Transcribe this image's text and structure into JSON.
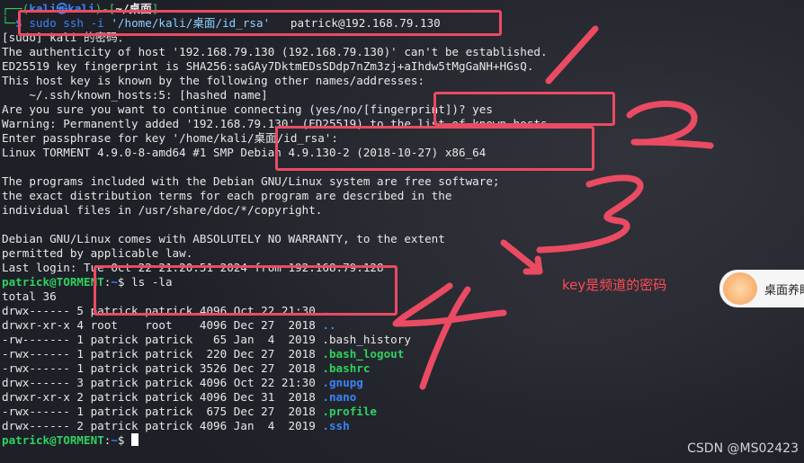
{
  "terminal": {
    "lines": [
      {
        "segments": [
          {
            "t": "┌──(",
            "c": "green"
          },
          {
            "t": "kali㉿kali",
            "c": "boldblue"
          },
          {
            "t": ")-[",
            "c": "green"
          },
          {
            "t": "~/桌面",
            "c": "bold"
          },
          {
            "t": "]",
            "c": "green"
          }
        ]
      },
      {
        "segments": [
          {
            "t": "└─",
            "c": "green"
          },
          {
            "t": "$ ",
            "c": "boldblue"
          },
          {
            "t": "sudo ssh -i ",
            "c": "blue"
          },
          {
            "t": "'/home/kali/桌面/id_rsa'",
            "c": "cyan"
          },
          {
            "t": "   patrick@192.168.79.130",
            "c": ""
          }
        ]
      },
      {
        "segments": [
          {
            "t": "[sudo] kali 的密码：",
            "c": ""
          }
        ]
      },
      {
        "segments": [
          {
            "t": "The authenticity of host '192.168.79.130 (192.168.79.130)' can't be established.",
            "c": ""
          }
        ]
      },
      {
        "segments": [
          {
            "t": "ED25519 key fingerprint is SHA256:saGAy7DktmEDsSDdp7nZm3zj+aIhdw5tMgGaNH+HGsQ.",
            "c": ""
          }
        ]
      },
      {
        "segments": [
          {
            "t": "This host key is known by the following other names/addresses:",
            "c": ""
          }
        ]
      },
      {
        "segments": [
          {
            "t": "    ~/.ssh/known_hosts:5: [hashed name]",
            "c": ""
          }
        ]
      },
      {
        "segments": [
          {
            "t": "Are you sure you want to continue connecting (yes/no/[fingerprint])? yes",
            "c": ""
          }
        ]
      },
      {
        "segments": [
          {
            "t": "Warning: Permanently added '192.168.79.130' (ED25519) to the list of known hosts.",
            "c": ""
          }
        ]
      },
      {
        "segments": [
          {
            "t": "Enter passphrase for key '/home/kali/桌面/id_rsa':",
            "c": ""
          }
        ]
      },
      {
        "segments": [
          {
            "t": "Linux TORMENT 4.9.0-8-amd64 #1 SMP Debian 4.9.130-2 (2018-10-27) x86_64",
            "c": ""
          }
        ]
      },
      {
        "segments": [
          {
            "t": "",
            "c": ""
          }
        ]
      },
      {
        "segments": [
          {
            "t": "The programs included with the Debian GNU/Linux system are free software;",
            "c": ""
          }
        ]
      },
      {
        "segments": [
          {
            "t": "the exact distribution terms for each program are described in the",
            "c": ""
          }
        ]
      },
      {
        "segments": [
          {
            "t": "individual files in /usr/share/doc/*/copyright.",
            "c": ""
          }
        ]
      },
      {
        "segments": [
          {
            "t": "",
            "c": ""
          }
        ]
      },
      {
        "segments": [
          {
            "t": "Debian GNU/Linux comes with ABSOLUTELY NO WARRANTY, to the extent",
            "c": ""
          }
        ]
      },
      {
        "segments": [
          {
            "t": "permitted by applicable law.",
            "c": ""
          }
        ]
      },
      {
        "segments": [
          {
            "t": "Last login: Tue Oct 22 21:20:51 2024 from 192.168.79.128",
            "c": ""
          }
        ]
      },
      {
        "segments": [
          {
            "t": "patrick@TORMENT",
            "c": "boldgreen"
          },
          {
            "t": ":",
            "c": ""
          },
          {
            "t": "~",
            "c": "boldblue"
          },
          {
            "t": "$ ls -la",
            "c": ""
          }
        ]
      },
      {
        "segments": [
          {
            "t": "total 36",
            "c": ""
          }
        ]
      },
      {
        "segments": [
          {
            "t": "drwx------ 5 patrick patrick 4096 Oct 22 21:30 ",
            "c": ""
          },
          {
            "t": ".",
            "c": "boldblue"
          }
        ]
      },
      {
        "segments": [
          {
            "t": "drwxr-xr-x 4 root    root    4096 Dec 27  2018 ",
            "c": ""
          },
          {
            "t": "..",
            "c": "boldblue"
          }
        ]
      },
      {
        "segments": [
          {
            "t": "-rw------- 1 patrick patrick   65 Jan  4  2019 .bash_history",
            "c": ""
          }
        ]
      },
      {
        "segments": [
          {
            "t": "-rwx------ 1 patrick patrick  220 Dec 27  2018 ",
            "c": ""
          },
          {
            "t": ".bash_logout",
            "c": "boldgreen"
          }
        ]
      },
      {
        "segments": [
          {
            "t": "-rwx------ 1 patrick patrick 3526 Dec 27  2018 ",
            "c": ""
          },
          {
            "t": ".bashrc",
            "c": "boldgreen"
          }
        ]
      },
      {
        "segments": [
          {
            "t": "drwx------ 3 patrick patrick 4096 Oct 22 21:30 ",
            "c": ""
          },
          {
            "t": ".gnupg",
            "c": "boldblue"
          }
        ]
      },
      {
        "segments": [
          {
            "t": "drwxr-xr-x 2 patrick patrick 4096 Dec 31  2018 ",
            "c": ""
          },
          {
            "t": ".nano",
            "c": "boldblue"
          }
        ]
      },
      {
        "segments": [
          {
            "t": "-rwx------ 1 patrick patrick  675 Dec 27  2018 ",
            "c": ""
          },
          {
            "t": ".profile",
            "c": "boldgreen"
          }
        ]
      },
      {
        "segments": [
          {
            "t": "drwx------ 2 patrick patrick 4096 Jan  4  2019 ",
            "c": ""
          },
          {
            "t": ".ssh",
            "c": "boldblue"
          }
        ]
      },
      {
        "segments": [
          {
            "t": "patrick@TORMENT",
            "c": "boldgreen"
          },
          {
            "t": ":",
            "c": ""
          },
          {
            "t": "~",
            "c": "boldblue"
          },
          {
            "t": "$ ",
            "c": ""
          }
        ]
      }
    ]
  },
  "annotations": {
    "note": "key是频道的密码",
    "colors": {
      "box": "#ea4b63",
      "text": "#ff4b55"
    }
  },
  "avatar": {
    "label": "桌面养眼"
  },
  "watermark": "CSDN @MS02423"
}
